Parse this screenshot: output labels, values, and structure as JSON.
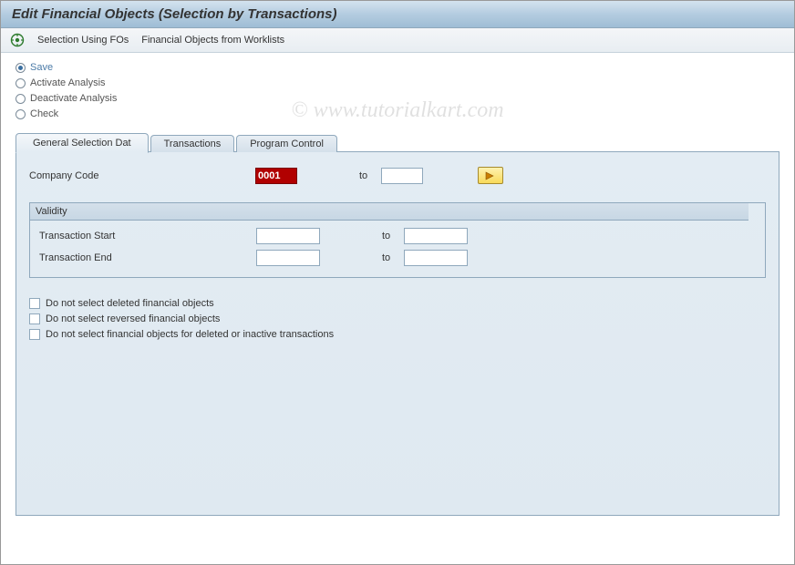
{
  "title": "Edit Financial Objects (Selection by Transactions)",
  "toolbar": {
    "selection_using_fos": "Selection Using FOs",
    "fo_from_worklists": "Financial Objects from Worklists"
  },
  "radios": {
    "save": "Save",
    "activate": "Activate Analysis",
    "deactivate": "Deactivate Analysis",
    "check": "Check"
  },
  "tabs": {
    "general": "General Selection Dat",
    "transactions": "Transactions",
    "program_control": "Program Control"
  },
  "fields": {
    "company_code_label": "Company Code",
    "company_code_value": "0001",
    "to": "to",
    "validity": {
      "legend": "Validity",
      "trans_start": "Transaction Start",
      "trans_end": "Transaction End"
    }
  },
  "checkboxes": {
    "cb1": "Do not select deleted financial objects",
    "cb2": "Do not select reversed financial objects",
    "cb3": "Do not select financial objects for deleted or inactive transactions"
  },
  "watermark": "© www.tutorialkart.com"
}
